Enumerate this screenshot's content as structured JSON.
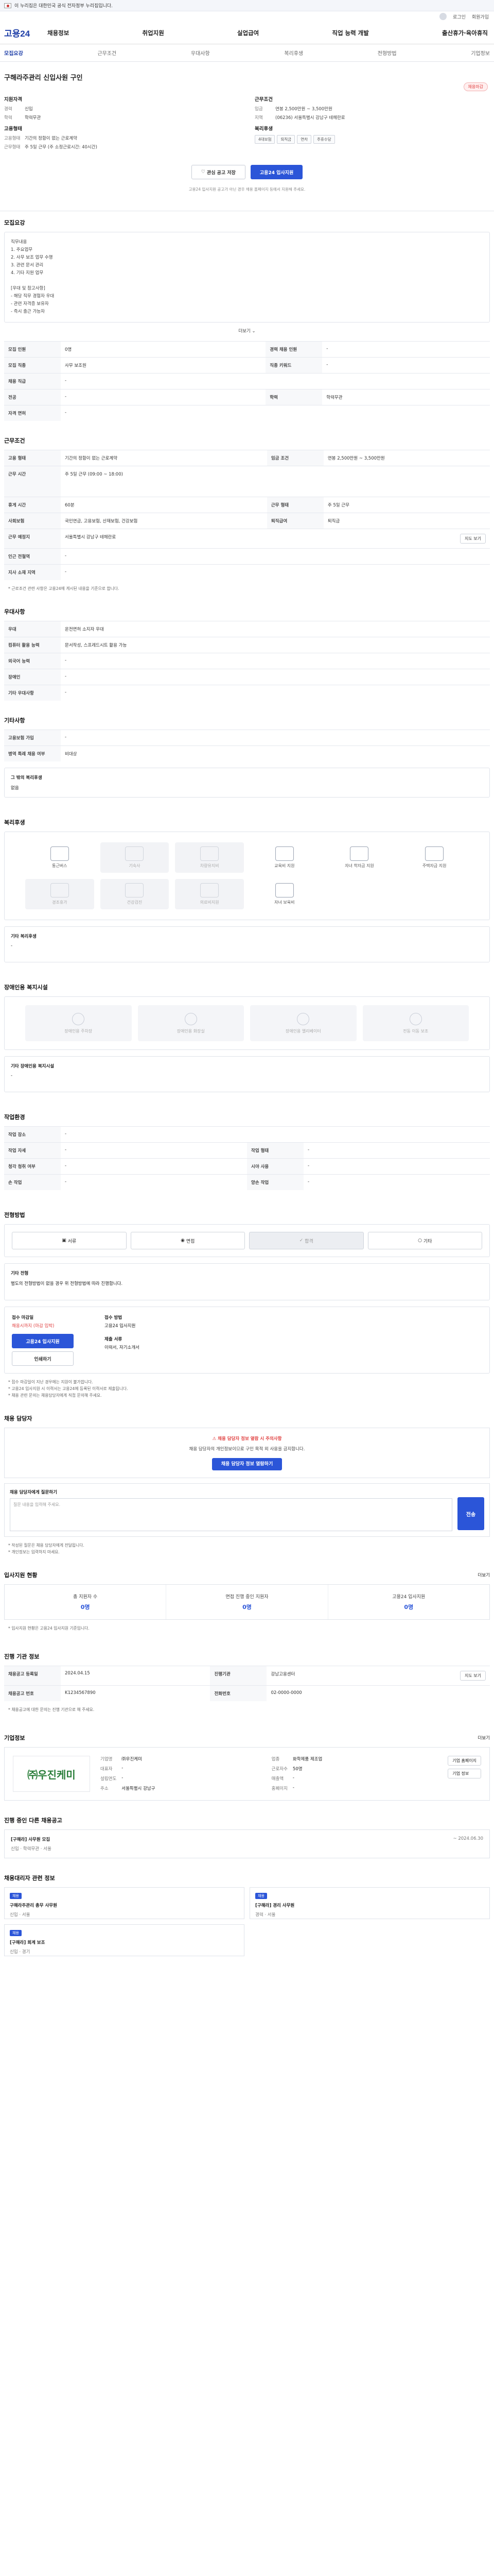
{
  "banner": {
    "text": "이 누리집은 대한민국 공식 전자정부 누리집입니다."
  },
  "util": {
    "login": "로그인",
    "join": "회원가입"
  },
  "gnb": {
    "logo": "고용24",
    "menu": [
      "채용정보",
      "취업지원",
      "실업급여",
      "직업 능력 개발",
      "출산휴가·육아휴직"
    ]
  },
  "tabs": [
    "모집요강",
    "근무조건",
    "우대사항",
    "복리후생",
    "전형방법",
    "기업정보"
  ],
  "job": {
    "company": "구해라주관리 신입사원 구인",
    "status": "채용마감",
    "left_head": "지원자격",
    "right_head": "근무조건",
    "left_rows": [
      {
        "k": "경력",
        "v": "신입"
      },
      {
        "k": "학력",
        "v": "학력무관"
      }
    ],
    "right_rows": [
      {
        "k": "임금",
        "v": "연봉 2,500만원 ~ 3,500만원"
      },
      {
        "k": "지역",
        "v": "(06236) 서울특별시 강남구 테헤란로"
      }
    ],
    "left_head2": "고용형태",
    "left_rows2": [
      {
        "k": "고용형태",
        "v": "기간의 정함이 없는 근로계약"
      },
      {
        "k": "근무형태",
        "v": "주 5일 근무 (주 소정근로시간: 40시간)"
      }
    ],
    "right_head2": "복리후생",
    "chips": [
      "4대보험",
      "퇴직금",
      "연차",
      "주휴수당"
    ],
    "btn_save": "관심 공고 저장",
    "btn_apply": "고용24 입사지원",
    "note": "고용24 입사지원 공고가 아닌 경우 채용 홈페이지 등에서 지원해 주세요."
  },
  "recruit": {
    "title": "모집요강",
    "body": [
      "직무내용",
      "",
      "1. 주요업무",
      "2. 사무 보조 업무 수행",
      "3. 관련 문서 관리",
      "4. 기타 지원 업무",
      "",
      "[우대 및 참고사항]",
      "- 해당 직무 경험자 우대",
      "- 관련 자격증 보유자",
      "- 즉시 출근 가능자"
    ],
    "more": "더보기",
    "rows": [
      {
        "k": "모집 인원",
        "v": "0명",
        "k2": "경력 채용 인원",
        "v2": "-"
      },
      {
        "k": "모집 직종",
        "v": "사무 보조원",
        "k2": "직종 키워드",
        "v2": "-"
      },
      {
        "k": "채용 직급",
        "v": "-",
        "k2": "",
        "v2": ""
      },
      {
        "k": "전공",
        "v": "-",
        "k2": "학력",
        "v2": "학력무관"
      },
      {
        "k": "자격 면허",
        "v": "-",
        "k2": "",
        "v2": ""
      }
    ]
  },
  "work": {
    "title": "근무조건",
    "rows": [
      {
        "k": "고용 형태",
        "v": "기간의 정함이 없는 근로계약",
        "k2": "임금 조건",
        "v2": "연봉 2,500만원 ~ 3,500만원"
      },
      {
        "k": "근무 시간",
        "v": "주 5일 근무 (09:00 ~ 18:00)",
        "k2": "",
        "v2": ""
      },
      {
        "k": "휴게 시간",
        "v": "60분",
        "k2": "근무 형태",
        "v2": "주 5일 근무"
      },
      {
        "k": "사회보험",
        "v": "국민연금, 고용보험, 산재보험, 건강보험",
        "k2": "퇴직급여",
        "v2": "퇴직금"
      },
      {
        "k": "근무 예정지",
        "v": "서울특별시 강남구 테헤란로",
        "k2": "",
        "v2": ""
      },
      {
        "k": "인근 전철역",
        "v": "-",
        "k2": "",
        "v2": ""
      },
      {
        "k": "지사 소재 지역",
        "v": "-",
        "k2": "",
        "v2": ""
      }
    ],
    "map_btn": "지도 보기",
    "note": "* 근로조건 관련 사항은 고용24에 게시된 내용을 기준으로 합니다."
  },
  "prefer": {
    "title": "우대사항",
    "rows": [
      {
        "k": "우대",
        "v": "운전면허 소지자 우대"
      },
      {
        "k": "컴퓨터 활용 능력",
        "v": "문서작성, 스프레드시트 활용 가능"
      },
      {
        "k": "외국어 능력",
        "v": "-"
      },
      {
        "k": "장애인",
        "v": "-"
      },
      {
        "k": "기타 우대사항",
        "v": "-"
      }
    ]
  },
  "etc": {
    "title": "기타사항",
    "rows": [
      {
        "k": "고용보험 가입",
        "v": "-"
      },
      {
        "k": "병역 특례 채용 여부",
        "v": "비대상"
      }
    ],
    "extra_title": "그 밖의 복리후생",
    "extra_v": "없음"
  },
  "welfare": {
    "title": "복리후생",
    "items": [
      "통근버스",
      "기숙사",
      "차량유지비",
      "교육비 지원",
      "자녀 학자금 지원",
      "주택자금 지원",
      "경조휴가",
      "건강검진",
      "의료비지원",
      "자녀 보육비"
    ],
    "other_title": "기타 복리후생",
    "other_v": "-"
  },
  "disab": {
    "title": "장애인용 복지시설",
    "items": [
      "장애인용 주차장",
      "장애인용 화장실",
      "장애인용 엘리베이터",
      "전동 이동 보조"
    ],
    "other_title": "기타 장애인용 복지시설",
    "other_v": "-"
  },
  "environ": {
    "title": "작업환경",
    "rows": [
      {
        "k": "작업 장소",
        "v": "-",
        "k2": "",
        "v2": ""
      },
      {
        "k": "작업 자세",
        "v": "-",
        "k2": "작업 형태",
        "v2": "-"
      },
      {
        "k": "청각 청취 여부",
        "v": "-",
        "k2": "시야 사용",
        "v2": "-"
      },
      {
        "k": "손 작업",
        "v": "-",
        "k2": "양손 작업",
        "v2": "-"
      }
    ]
  },
  "process": {
    "title": "전형방법",
    "steps": [
      "서류",
      "면접",
      "합격",
      "기타"
    ],
    "other_title": "기타 전형",
    "other_v": "별도의 전형방법이 없을 경우 위 전형방법에 따라 진행합니다."
  },
  "apply": {
    "deadline_head": "접수 마감일",
    "deadline": "채용시까지 (마감 임박)",
    "method_head": "접수 방법",
    "method": "고용24 입사지원",
    "btn_apply": "고용24 입사지원",
    "btn_print": "인쇄하기",
    "doc_head": "제출 서류",
    "doc": "이력서, 자기소개서",
    "notes": [
      "* 접수 마감일이 지난 경우에는 지원이 불가합니다.",
      "* 고용24 입사지원 시 이력서는 고용24에 등록된 이력서로 제출됩니다.",
      "* 채용 관련 문의는 채용담당자에게 직접 문의해 주세요."
    ]
  },
  "manager": {
    "title": "채용 담당자",
    "warn_title": "채용 담당자 정보 열람 시 주의사항",
    "warn_body": "채용 담당자의 개인정보이므로 구인 목적 외 사용을 금지합니다.",
    "btn_view": "채용 담당자 정보 열람하기",
    "comment_head": "채용 담당자에게 질문하기",
    "comment_ph": "질문 내용을 입력해 주세요.",
    "send": "전송",
    "notes": [
      "* 작성된 질문은 채용 담당자에게 전달됩니다.",
      "* 개인정보는 입력하지 마세요."
    ]
  },
  "applicants": {
    "title": "입사지원 현황",
    "more": "더보기",
    "stats": [
      {
        "k": "총 지원자 수",
        "v": "0명"
      },
      {
        "k": "면접 진행 중인 지원자",
        "v": "0명"
      },
      {
        "k": "고용24 입사지원",
        "v": "0명"
      }
    ],
    "note": "* 입사지원 현황은 고용24 입사지원 기준입니다."
  },
  "posting": {
    "title": "진행 기관 정보",
    "rows": [
      {
        "k": "채용공고 등록일",
        "v": "2024.04.15",
        "k2": "진행기관",
        "v2": "강남고용센터"
      },
      {
        "k": "채용공고 번호",
        "v": "K1234567890",
        "k2": "전화번호",
        "v2": "02-0000-0000"
      }
    ],
    "btn": "지도 보기",
    "note": "* 채용공고에 대한 문의는 진행 기관으로 해 주세요."
  },
  "company": {
    "title": "기업정보",
    "more": "더보기",
    "logo": "㈜우진케미",
    "rows": [
      {
        "k": "기업명",
        "v": "㈜우진케미",
        "k2": "업종",
        "v2": "화학제품 제조업"
      },
      {
        "k": "대표자",
        "v": "-",
        "k2": "근로자수",
        "v2": "50명"
      },
      {
        "k": "설립연도",
        "v": "-",
        "k2": "매출액",
        "v2": "-"
      },
      {
        "k": "주소",
        "v": "서울특별시 강남구",
        "k2": "홈페이지",
        "v2": "-"
      }
    ],
    "btn_home": "기업 홈페이지",
    "btn_info": "기업 정보"
  },
  "similar": {
    "title": "진행 중인 다른 채용공고",
    "items": [
      {
        "title": "[구해라] 사무원 모집",
        "sub": "신입 · 학력무관 · 서울",
        "date": "~ 2024.06.30"
      }
    ]
  },
  "related": {
    "title": "채용대리자 관련 정보",
    "cards": [
      {
        "badge": "채용",
        "t": "구해라주관리 총무 사무원",
        "s": "신입 · 서울"
      },
      {
        "badge": "채용",
        "t": "[구해라] 경리 사무원",
        "s": "경력 · 서울"
      },
      {
        "badge": "채용",
        "t": "[구해라] 회계 보조",
        "s": "신입 · 경기"
      }
    ]
  }
}
